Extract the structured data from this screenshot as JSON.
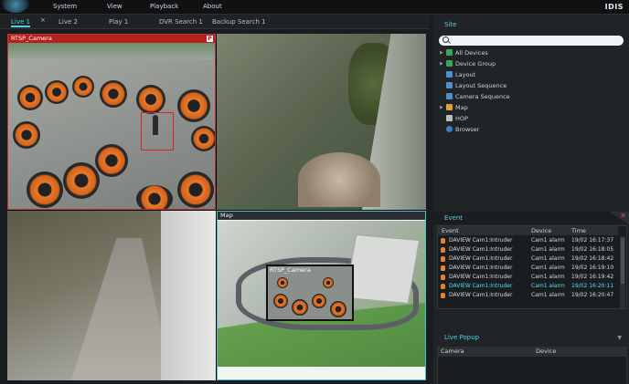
{
  "menu": {
    "items": [
      "System",
      "View",
      "Playback",
      "About"
    ],
    "brand": "IDIS"
  },
  "tabs": [
    {
      "label": "Live 1",
      "active": true
    },
    {
      "label": "Live 2",
      "active": false
    },
    {
      "label": "Play 1",
      "active": false
    },
    {
      "label": "DVR Search 1",
      "active": false
    },
    {
      "label": "Backup Search 1",
      "active": false
    }
  ],
  "tab_close": "×",
  "video": {
    "cam1_title": "RTSP_Camera",
    "cam1_badge": "P",
    "map_title": "Map",
    "mini_cam_title": "RTSP_Camera"
  },
  "site": {
    "title": "Site",
    "search_placeholder": "",
    "tree": [
      {
        "label": "All Devices",
        "icon_color": "#3aa655",
        "expandable": true
      },
      {
        "label": "Device Group",
        "icon_color": "#3aa655",
        "expandable": true
      },
      {
        "label": "Layout",
        "icon_color": "#4f8fd0",
        "expandable": false
      },
      {
        "label": "Layout Sequence",
        "icon_color": "#4f8fd0",
        "expandable": false
      },
      {
        "label": "Camera Sequence",
        "icon_color": "#4f8fd0",
        "expandable": false
      },
      {
        "label": "Map",
        "icon_color": "#e0a32e",
        "expandable": true
      },
      {
        "label": "HOP",
        "icon_color": "#b8bdc2",
        "expandable": false
      },
      {
        "label": "Browser",
        "icon_color": "#3a7ec2",
        "expandable": false
      }
    ]
  },
  "event": {
    "title": "Event",
    "close_icon": "✕",
    "columns": [
      "Event",
      "Device",
      "Time"
    ],
    "rows": [
      {
        "event": "DAVIEW Cam1:Intruder",
        "device": "Cam1 alarm",
        "time": "19/02 16:17:37",
        "highlight": false
      },
      {
        "event": "DAVIEW Cam1:Intruder",
        "device": "Cam1 alarm",
        "time": "19/02 16:18:05",
        "highlight": false
      },
      {
        "event": "DAVIEW Cam1:Intruder",
        "device": "Cam1 alarm",
        "time": "19/02 16:18:42",
        "highlight": false
      },
      {
        "event": "DAVIEW Cam1:Intruder",
        "device": "Cam1 alarm",
        "time": "19/02 16:19:10",
        "highlight": false
      },
      {
        "event": "DAVIEW Cam1:Intruder",
        "device": "Cam1 alarm",
        "time": "19/02 16:19:42",
        "highlight": false
      },
      {
        "event": "DAVIEW Cam1:Intruder",
        "device": "Cam1 alarm",
        "time": "19/02 16:20:11",
        "highlight": true
      },
      {
        "event": "DAVIEW Cam1:Intruder",
        "device": "Cam1 alarm",
        "time": "19/02 16:20:47",
        "highlight": false
      }
    ]
  },
  "live_popup": {
    "title": "Live Popup",
    "columns": [
      "Camera",
      "Device"
    ]
  },
  "colors": {
    "accent": "#4fd0e0",
    "alarm": "#b82020"
  }
}
